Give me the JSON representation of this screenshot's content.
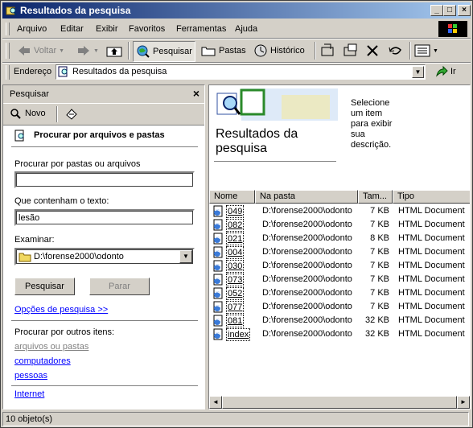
{
  "window": {
    "title": "Resultados da pesquisa"
  },
  "menu": [
    "Arquivo",
    "Editar",
    "Exibir",
    "Favoritos",
    "Ferramentas",
    "Ajuda"
  ],
  "toolbar": {
    "back": "Voltar",
    "search": "Pesquisar",
    "folders": "Pastas",
    "history": "Histórico"
  },
  "address": {
    "label": "Endereço",
    "value": "Resultados da pesquisa",
    "go": "Ir"
  },
  "search_panel": {
    "header": "Pesquisar",
    "new_label": "Novo",
    "heading": "Procurar por arquivos e pastas",
    "name_label": "Procurar por pastas ou arquivos",
    "name_value": "",
    "text_label": "Que contenham o texto:",
    "text_value": "lesão",
    "look_label": "Examinar:",
    "look_value": "D:\\forense2000\\odonto",
    "search_btn": "Pesquisar",
    "stop_btn": "Parar",
    "options_link": "Opções de pesquisa >>",
    "other_label": "Procurar por outros itens:",
    "other_links": [
      "arquivos ou pastas",
      "computadores",
      "pessoas"
    ],
    "internet_link": "Internet"
  },
  "preview": {
    "title": "Resultados da pesquisa",
    "hint": "Selecione um item para exibir sua descrição."
  },
  "list": {
    "columns": [
      "Nome",
      "Na pasta",
      "Tam...",
      "Tipo"
    ],
    "rows": [
      {
        "name": "049",
        "folder": "D:\\forense2000\\odonto",
        "size": "7 KB",
        "type": "HTML Document"
      },
      {
        "name": "082",
        "folder": "D:\\forense2000\\odonto",
        "size": "7 KB",
        "type": "HTML Document"
      },
      {
        "name": "021",
        "folder": "D:\\forense2000\\odonto",
        "size": "8 KB",
        "type": "HTML Document"
      },
      {
        "name": "004",
        "folder": "D:\\forense2000\\odonto",
        "size": "7 KB",
        "type": "HTML Document"
      },
      {
        "name": "030",
        "folder": "D:\\forense2000\\odonto",
        "size": "7 KB",
        "type": "HTML Document"
      },
      {
        "name": "073",
        "folder": "D:\\forense2000\\odonto",
        "size": "7 KB",
        "type": "HTML Document"
      },
      {
        "name": "052",
        "folder": "D:\\forense2000\\odonto",
        "size": "7 KB",
        "type": "HTML Document"
      },
      {
        "name": "077",
        "folder": "D:\\forense2000\\odonto",
        "size": "7 KB",
        "type": "HTML Document"
      },
      {
        "name": "081",
        "folder": "D:\\forense2000\\odonto",
        "size": "32 KB",
        "type": "HTML Document"
      },
      {
        "name": "index",
        "folder": "D:\\forense2000\\odonto",
        "size": "32 KB",
        "type": "HTML Document"
      }
    ]
  },
  "status": {
    "text": "10 objeto(s)"
  }
}
